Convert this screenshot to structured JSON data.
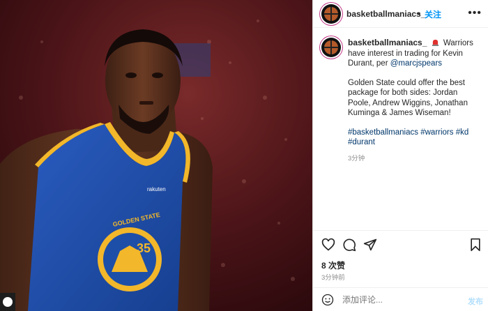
{
  "post": {
    "username": "basketballmaniacs_",
    "separator": "•",
    "follow_label": "关注",
    "more_label": "•••",
    "caption": {
      "headline_text": "Warriors have interest in trading for Kevin Durant, per ",
      "mention": "@marcjspears",
      "body": "Golden State could offer the best package for both sides: Jordan Poole, Andrew Wiggins, Jonathan Kuminga & James Wiseman!",
      "hashtags": [
        "#basketballmaniacs",
        "#warriors",
        "#kd",
        "#durant"
      ],
      "time": "3分钟"
    },
    "likes": "8 次赞",
    "posted_time": "3分钟前",
    "comment_placeholder": "添加评论...",
    "post_button": "发布"
  },
  "photo": {
    "jersey_number": "35",
    "jersey_text": "GOLDEN STATE",
    "sponsor": "rakuten"
  },
  "colors": {
    "accent": "#0095f6",
    "link": "#00376b",
    "jersey_blue": "#1d4fa8",
    "jersey_gold": "#f2b72a"
  }
}
